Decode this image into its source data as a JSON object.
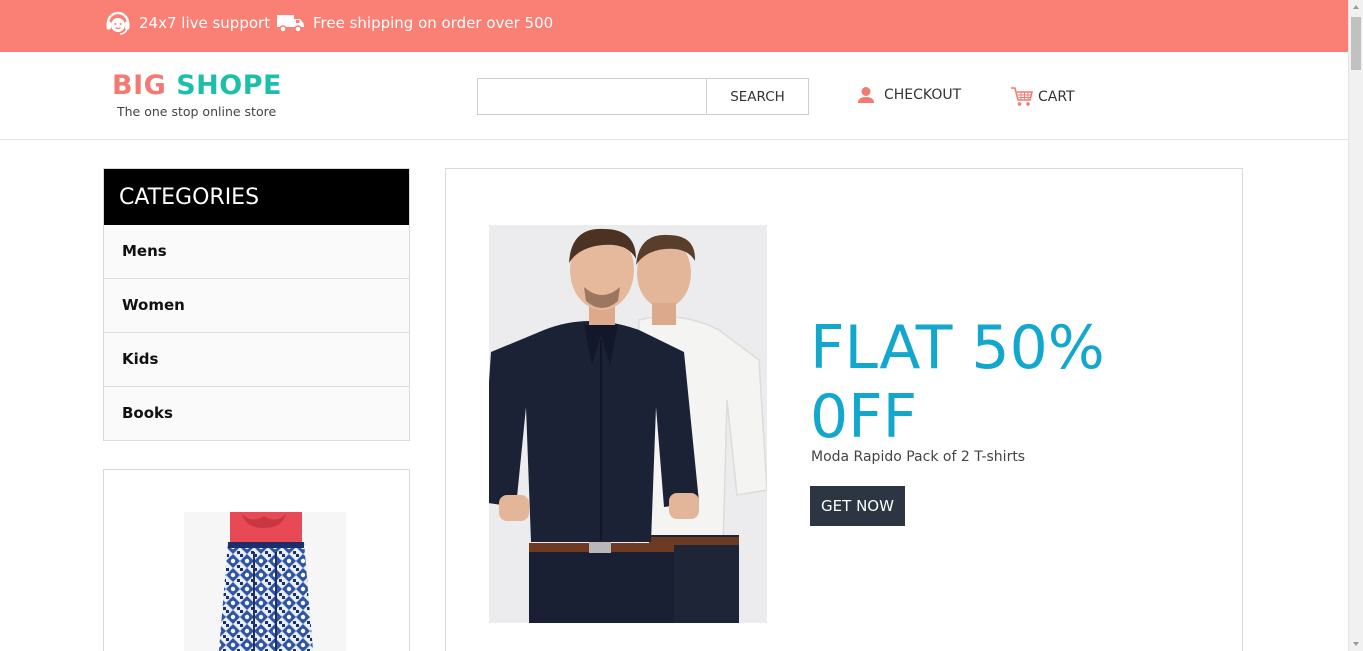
{
  "topbar": {
    "support_text": "24x7 live support",
    "shipping_text": "Free shipping on order over 500",
    "background": "#fa7f74"
  },
  "header": {
    "logo_word1": "BIG",
    "logo_word2": "SHOPE",
    "tagline": "The one stop online store",
    "logo_colors": [
      "#f27a72",
      "#1dbfaa"
    ],
    "search": {
      "placeholder": "",
      "value": "",
      "button_label": "SEARCH"
    },
    "checkout_label": "CHECKOUT",
    "cart_label": "CART"
  },
  "sidebar": {
    "heading": "CATEGORIES",
    "items": [
      {
        "label": "Mens"
      },
      {
        "label": "Women"
      },
      {
        "label": "Kids"
      },
      {
        "label": "Books"
      }
    ]
  },
  "banner": {
    "headline": "FLAT 50% 0FF",
    "subtitle": "Moda Rapido Pack of 2 T-shirts",
    "button_label": "GET NOW",
    "headline_color": "#12a8cd",
    "button_color": "#2c3642"
  }
}
